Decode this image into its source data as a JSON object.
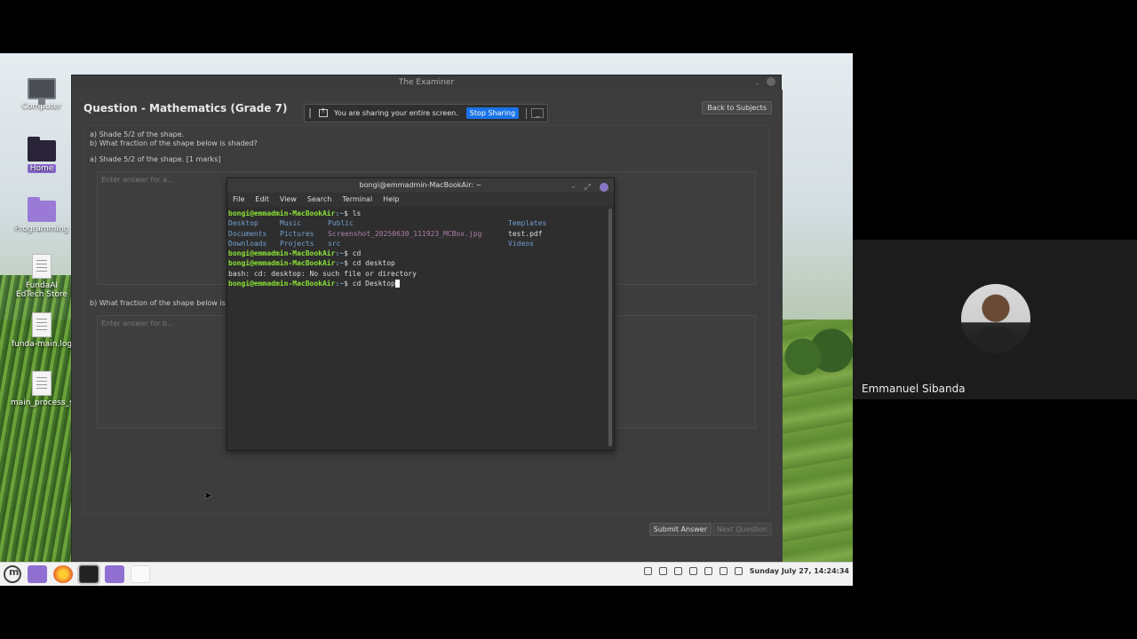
{
  "desktop": {
    "icons": [
      {
        "label": "Computer"
      },
      {
        "label": "Home"
      },
      {
        "label": "Programming"
      },
      {
        "label": "FundaAI EdTech Store"
      },
      {
        "label": "funda-main.log"
      },
      {
        "label": "main_process_started_TEST.txt"
      }
    ]
  },
  "examiner": {
    "window_title": "The Examiner",
    "question_title": "Question - Mathematics (Grade 7)",
    "back_button": "Back to Subjects",
    "question_line1": "a) Shade 5/2 of the shape.",
    "question_line2": "b) What fraction of the shape below is shaded?",
    "part_a_label": "a) Shade 5/2 of the shape. [1 marks]",
    "part_a_placeholder": "Enter answer for a...",
    "part_b_label": "b) What fraction of the shape below is s",
    "part_b_placeholder": "Enter answer for b...",
    "submit_button": "Submit Answer",
    "next_button": "Next Question"
  },
  "share_bar": {
    "message": "You are sharing your entire screen.",
    "stop_button": "Stop Sharing",
    "hide_button": "_"
  },
  "terminal": {
    "title": "bongi@emmadmin-MacBookAir: ~",
    "menu": [
      "File",
      "Edit",
      "View",
      "Search",
      "Terminal",
      "Help"
    ],
    "prompt_user": "bongi@emmadmin-MacBookAir",
    "prompt_path": ":~",
    "lines": {
      "cmd1": "$ ls",
      "ls_row1": [
        "Desktop",
        "Music",
        "Public",
        "",
        "Templates"
      ],
      "ls_row2": [
        "Documents",
        "Pictures",
        "Screenshot_20250630_111923_MCBox.jpg",
        "test.pdf"
      ],
      "ls_row3": [
        "Downloads",
        "Projects",
        "src",
        "",
        "Videos"
      ],
      "cmd2": "$ cd",
      "cmd3": "$ cd desktop",
      "error": "bash: cd: desktop: No such file or directory",
      "cmd4": "$ cd Desktop"
    }
  },
  "taskbar": {
    "clock": "Sunday July 27, 14:24:34"
  },
  "video": {
    "participant_name": "Emmanuel Sibanda"
  }
}
